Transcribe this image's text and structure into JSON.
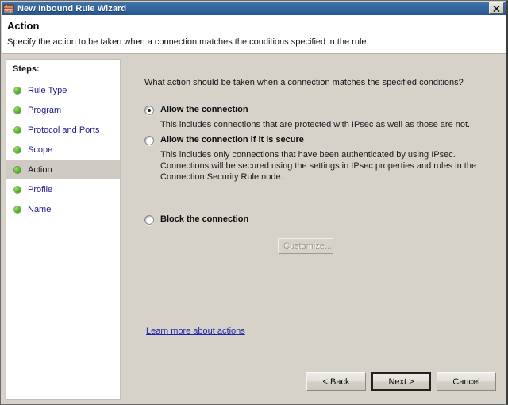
{
  "window": {
    "title": "New Inbound Rule Wizard",
    "icon": "firewall-brick-icon",
    "close_label": "X"
  },
  "header": {
    "title": "Action",
    "subtitle": "Specify the action to be taken when a connection matches the conditions specified in the rule."
  },
  "sidebar": {
    "label": "Steps:",
    "items": [
      {
        "label": "Rule Type",
        "current": false
      },
      {
        "label": "Program",
        "current": false
      },
      {
        "label": "Protocol and Ports",
        "current": false
      },
      {
        "label": "Scope",
        "current": false
      },
      {
        "label": "Action",
        "current": true
      },
      {
        "label": "Profile",
        "current": false
      },
      {
        "label": "Name",
        "current": false
      }
    ]
  },
  "main": {
    "prompt": "What action should be taken when a connection matches the specified conditions?",
    "options": [
      {
        "id": "allow",
        "title": "Allow the connection",
        "description": "This includes connections that are protected with IPsec as well as those are not.",
        "selected": true
      },
      {
        "id": "allow-secure",
        "title": "Allow the connection if it is secure",
        "description": "This includes only connections that have been authenticated by using IPsec.  Connections will be secured using the settings in IPsec properties and rules in the Connection Security Rule node.",
        "selected": false
      },
      {
        "id": "block",
        "title": "Block the connection",
        "description": "",
        "selected": false
      }
    ],
    "customize_label": "Customize...",
    "customize_enabled": false,
    "learn_more_label": "Learn more about actions"
  },
  "footer": {
    "back_label": "< Back",
    "next_label": "Next >",
    "cancel_label": "Cancel",
    "default_button": "next"
  },
  "colors": {
    "titlebar_blue": "#3a6ea5",
    "dialog_face": "#d6d2ca",
    "link_blue": "#2323a8",
    "step_bullet_green": "#5fc02c",
    "step_label_blue": "#1a1a8c"
  }
}
